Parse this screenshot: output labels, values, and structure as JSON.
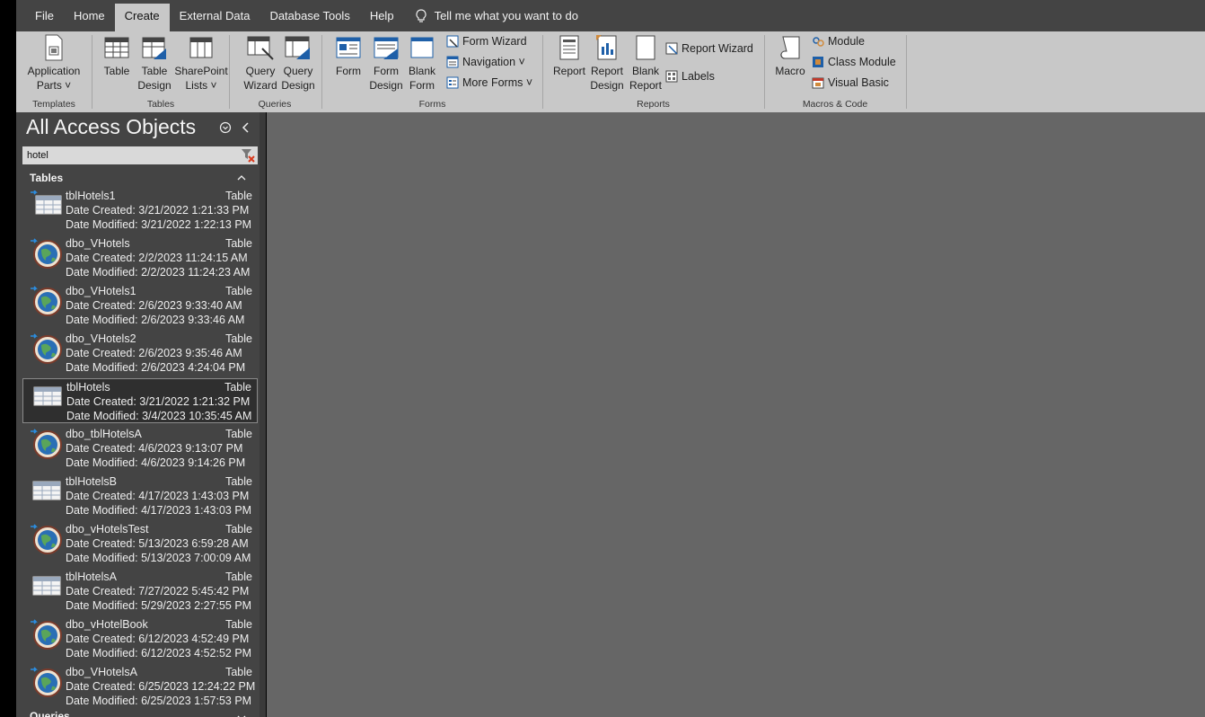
{
  "menu": {
    "tabs": [
      "File",
      "Home",
      "Create",
      "External Data",
      "Database Tools",
      "Help"
    ],
    "active": "Create",
    "tell_me": "Tell me what you want to do"
  },
  "ribbon": {
    "templates": {
      "label": "Templates",
      "application_parts": "Application",
      "application_parts_2": "Parts ˅"
    },
    "tables": {
      "label": "Tables",
      "table": "Table",
      "table_design_1": "Table",
      "table_design_2": "Design",
      "sharepoint_1": "SharePoint",
      "sharepoint_2": "Lists ˅"
    },
    "queries": {
      "label": "Queries",
      "wizard_1": "Query",
      "wizard_2": "Wizard",
      "design_1": "Query",
      "design_2": "Design"
    },
    "forms": {
      "label": "Forms",
      "form": "Form",
      "form_design_1": "Form",
      "form_design_2": "Design",
      "blank_form_1": "Blank",
      "blank_form_2": "Form",
      "form_wizard": "Form Wizard",
      "navigation": "Navigation ˅",
      "more_forms": "More Forms ˅"
    },
    "reports": {
      "label": "Reports",
      "report": "Report",
      "report_design_1": "Report",
      "report_design_2": "Design",
      "blank_report_1": "Blank",
      "blank_report_2": "Report",
      "report_wizard": "Report Wizard",
      "labels": "Labels"
    },
    "macros": {
      "label": "Macros & Code",
      "macro": "Macro",
      "module": "Module",
      "class_module": "Class Module",
      "visual_basic": "Visual Basic"
    }
  },
  "nav": {
    "title": "All Access Objects",
    "search_value": "hotel",
    "section_tables": "Tables",
    "section_queries": "Queries",
    "items": [
      {
        "name": "tblHotels1",
        "type": "Table",
        "created": "Date Created: 3/21/2022 1:21:33 PM",
        "modified": "Date Modified: 3/21/2022 1:22:13 PM",
        "kind": "linked-table"
      },
      {
        "name": "dbo_VHotels",
        "type": "Table",
        "created": "Date Created: 2/2/2023 11:24:15 AM",
        "modified": "Date Modified: 2/2/2023 11:24:23 AM",
        "kind": "odbc"
      },
      {
        "name": "dbo_VHotels1",
        "type": "Table",
        "created": "Date Created: 2/6/2023 9:33:40 AM",
        "modified": "Date Modified: 2/6/2023 9:33:46 AM",
        "kind": "odbc"
      },
      {
        "name": "dbo_VHotels2",
        "type": "Table",
        "created": "Date Created: 2/6/2023 9:35:46 AM",
        "modified": "Date Modified: 2/6/2023 4:24:04 PM",
        "kind": "odbc"
      },
      {
        "name": "tblHotels",
        "type": "Table",
        "created": "Date Created: 3/21/2022 1:21:32 PM",
        "modified": "Date Modified: 3/4/2023 10:35:45 AM",
        "kind": "table",
        "selected": true
      },
      {
        "name": "dbo_tblHotelsA",
        "type": "Table",
        "created": "Date Created: 4/6/2023 9:13:07 PM",
        "modified": "Date Modified: 4/6/2023 9:14:26 PM",
        "kind": "odbc"
      },
      {
        "name": "tblHotelsB",
        "type": "Table",
        "created": "Date Created: 4/17/2023 1:43:03 PM",
        "modified": "Date Modified: 4/17/2023 1:43:03 PM",
        "kind": "table"
      },
      {
        "name": "dbo_vHotelsTest",
        "type": "Table",
        "created": "Date Created: 5/13/2023 6:59:28 AM",
        "modified": "Date Modified: 5/13/2023 7:00:09 AM",
        "kind": "odbc"
      },
      {
        "name": "tblHotelsA",
        "type": "Table",
        "created": "Date Created: 7/27/2022 5:45:42 PM",
        "modified": "Date Modified: 5/29/2023 2:27:55 PM",
        "kind": "table"
      },
      {
        "name": "dbo_vHotelBook",
        "type": "Table",
        "created": "Date Created: 6/12/2023 4:52:49 PM",
        "modified": "Date Modified: 6/12/2023 4:52:52 PM",
        "kind": "odbc"
      },
      {
        "name": "dbo_VHotelsA",
        "type": "Table",
        "created": "Date Created: 6/25/2023 12:24:22 PM",
        "modified": "Date Modified: 6/25/2023 1:57:53 PM",
        "kind": "odbc"
      }
    ]
  },
  "icons": {
    "table": "table-icon",
    "linked_table": "linked-table-icon",
    "odbc": "odbc-globe-icon",
    "filter_clear": "clear-filter-icon",
    "lightbulb": "lightbulb-icon"
  },
  "colors": {
    "ribbon_bg": "#c8c8c8",
    "menubar_bg": "#444444",
    "nav_bg": "#444444",
    "workarea_bg": "#666666",
    "selected_item_bg": "#2f2f2f",
    "accent_blue": "#1e5fa8"
  }
}
